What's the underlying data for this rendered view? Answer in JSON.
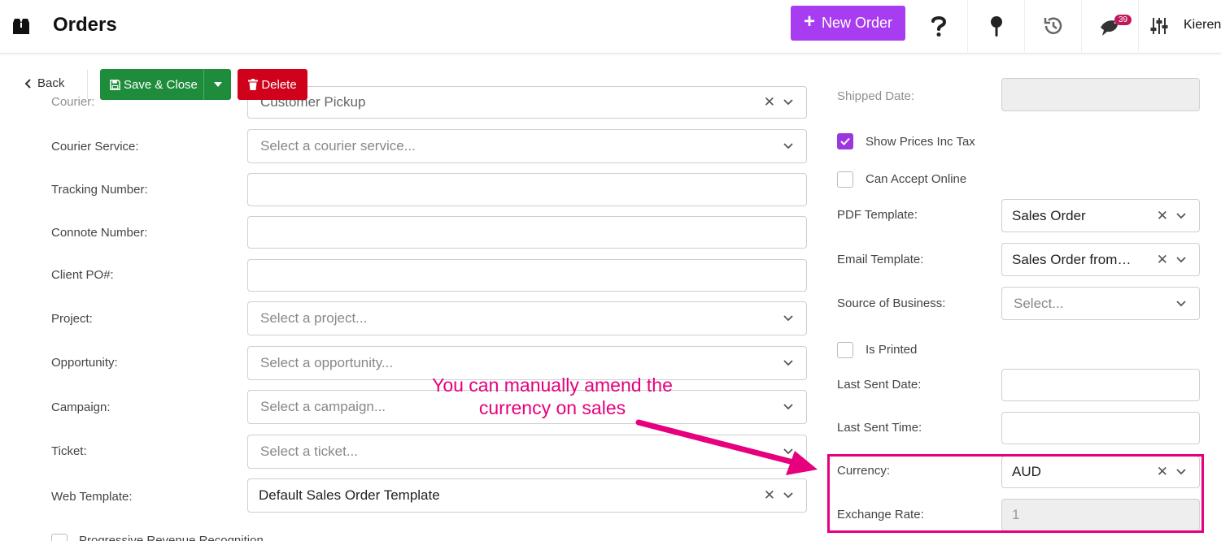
{
  "header": {
    "title": "Orders",
    "new_order_label": "New Order",
    "notification_count": "39",
    "user_name": "Kieren"
  },
  "actions": {
    "back_label": "Back",
    "save_label": "Save & Close",
    "delete_label": "Delete"
  },
  "left_form": {
    "courier": {
      "label": "Courier:",
      "value": "Customer Pickup"
    },
    "courier_service": {
      "label": "Courier Service:",
      "placeholder": "Select a courier service..."
    },
    "tracking_number": {
      "label": "Tracking Number:",
      "value": ""
    },
    "connote_number": {
      "label": "Connote Number:",
      "value": ""
    },
    "client_po": {
      "label": "Client PO#:",
      "value": ""
    },
    "project": {
      "label": "Project:",
      "placeholder": "Select a project..."
    },
    "opportunity": {
      "label": "Opportunity:",
      "placeholder": "Select a opportunity..."
    },
    "campaign": {
      "label": "Campaign:",
      "placeholder": "Select a campaign..."
    },
    "ticket": {
      "label": "Ticket:",
      "placeholder": "Select a ticket..."
    },
    "web_template": {
      "label": "Web Template:",
      "value": "Default Sales Order Template"
    },
    "progressive_revenue": {
      "label": "Progressive Revenue Recognition",
      "checked": false
    }
  },
  "right_form": {
    "shipped_date": {
      "label": "Shipped Date:",
      "value": ""
    },
    "show_prices_inc_tax": {
      "label": "Show Prices Inc Tax",
      "checked": true
    },
    "can_accept_online": {
      "label": "Can Accept Online",
      "checked": false
    },
    "pdf_template": {
      "label": "PDF Template:",
      "value": "Sales Order"
    },
    "email_template": {
      "label": "Email Template:",
      "value": "Sales Order from Company"
    },
    "source_of_business": {
      "label": "Source of Business:",
      "placeholder": "Select..."
    },
    "is_printed": {
      "label": "Is Printed",
      "checked": false
    },
    "last_sent_date": {
      "label": "Last Sent Date:",
      "value": ""
    },
    "last_sent_time": {
      "label": "Last Sent Time:",
      "value": ""
    },
    "currency": {
      "label": "Currency:",
      "value": "AUD"
    },
    "exchange_rate": {
      "label": "Exchange Rate:",
      "value": "1"
    }
  },
  "annotation": {
    "text": "You can manually amend the currency on sales",
    "color": "#e6007e"
  },
  "colors": {
    "accent": "#a83cf0",
    "save": "#1e8c3a",
    "delete": "#d0021b",
    "badge": "#c2185b"
  }
}
